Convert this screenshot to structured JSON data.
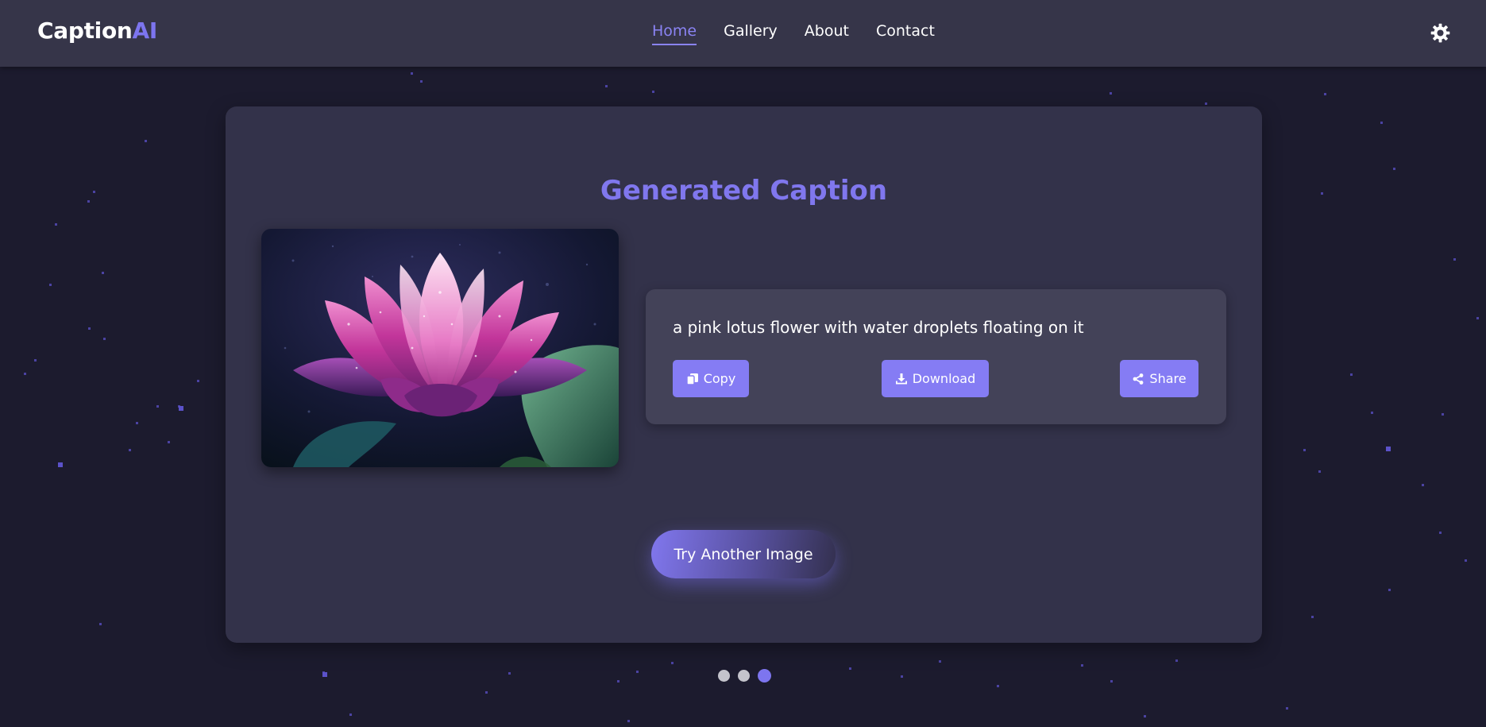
{
  "brand": {
    "name": "Caption",
    "accent": "AI"
  },
  "nav": {
    "items": [
      {
        "label": "Home",
        "active": true
      },
      {
        "label": "Gallery",
        "active": false
      },
      {
        "label": "About",
        "active": false
      },
      {
        "label": "Contact",
        "active": false
      }
    ],
    "settings_icon": "gear-icon"
  },
  "result": {
    "title": "Generated Caption",
    "image": "lotus-flower-photo",
    "caption": "a pink lotus flower with water droplets floating on it",
    "actions": {
      "copy_label": "Copy",
      "download_label": "Download",
      "share_label": "Share"
    },
    "try_another_label": "Try Another Image"
  },
  "pagination": {
    "total": 3,
    "active": 3
  },
  "colors": {
    "background": "#1c1b2e",
    "header": "#363549",
    "card": "#33324a",
    "caption_panel": "#434258",
    "accent": "#857cf4",
    "title": "#8077ee"
  }
}
